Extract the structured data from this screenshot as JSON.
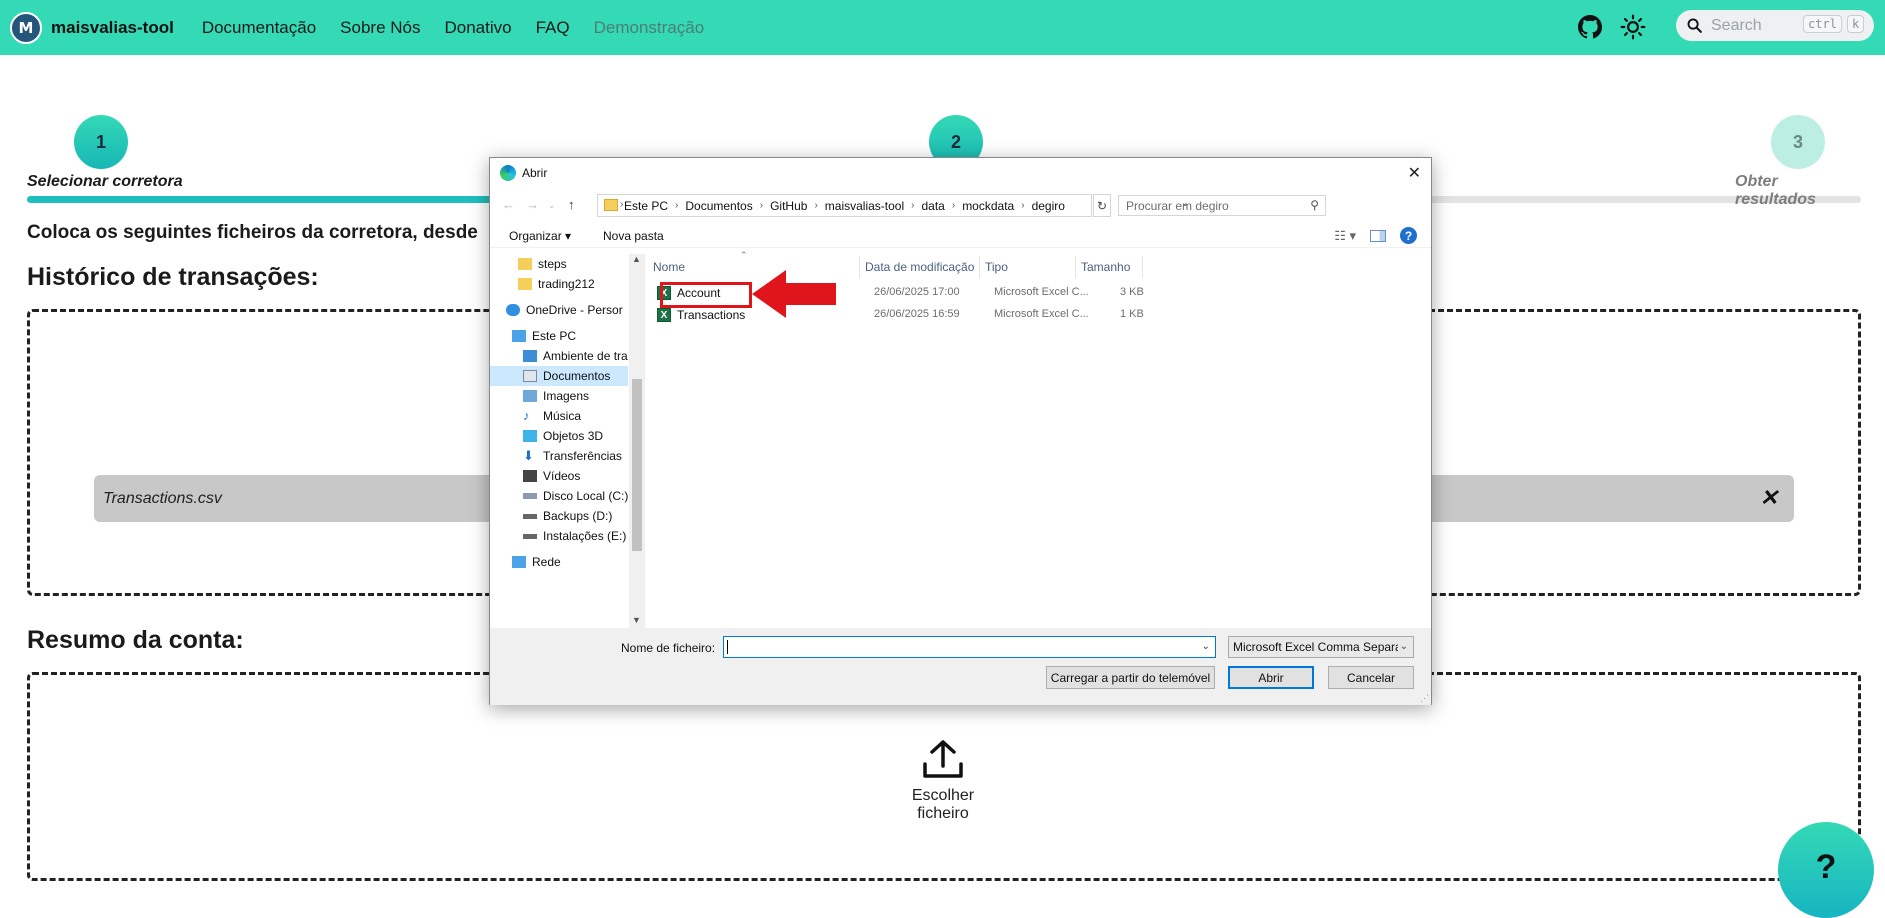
{
  "navbar": {
    "brand": "maisvalias-tool",
    "links": [
      "Documentação",
      "Sobre Nós",
      "Donativo",
      "FAQ",
      "Demonstração"
    ],
    "search_placeholder": "Search",
    "kbd_ctrl": "ctrl",
    "kbd_k": "k",
    "icons": [
      "github-icon",
      "sun-icon",
      "search-icon"
    ]
  },
  "stepper": {
    "steps": [
      {
        "number": "1",
        "label": "Selecionar corretora"
      },
      {
        "number": "2",
        "label": ""
      },
      {
        "number": "3",
        "label": "Obter resultados"
      }
    ]
  },
  "main": {
    "intro": "Coloca os seguintes ficheiros da corretora, desde",
    "section1_title": "Histórico de transações:",
    "uploaded_file": "Transactions.csv",
    "section2_title": "Resumo da conta:",
    "upload_label": "Escolher ficheiro",
    "help_label": "?"
  },
  "dialog": {
    "title": "Abrir",
    "breadcrumb": [
      "Este PC",
      "Documentos",
      "GitHub",
      "maisvalias-tool",
      "data",
      "mockdata",
      "degiro"
    ],
    "search_placeholder": "Procurar em degiro",
    "toolbar": {
      "organize": "Organizar ▾",
      "new_folder": "Nova pasta"
    },
    "nav_items": [
      {
        "label": "steps",
        "icon": "folder-icon"
      },
      {
        "label": "trading212",
        "icon": "folder-icon"
      },
      {
        "label": "OneDrive - Persor",
        "icon": "onedrive-icon"
      },
      {
        "label": "Este PC",
        "icon": "pc-icon"
      },
      {
        "label": "Ambiente de tra",
        "icon": "desktop-icon"
      },
      {
        "label": "Documentos",
        "icon": "documents-icon"
      },
      {
        "label": "Imagens",
        "icon": "pictures-icon"
      },
      {
        "label": "Música",
        "icon": "music-icon"
      },
      {
        "label": "Objetos 3D",
        "icon": "objects3d-icon"
      },
      {
        "label": "Transferências",
        "icon": "downloads-icon"
      },
      {
        "label": "Vídeos",
        "icon": "videos-icon"
      },
      {
        "label": "Disco Local (C:)",
        "icon": "drive-icon"
      },
      {
        "label": "Backups (D:)",
        "icon": "drive-icon"
      },
      {
        "label": "Instalações (E:)",
        "icon": "drive-icon"
      },
      {
        "label": "Rede",
        "icon": "network-icon"
      }
    ],
    "columns": [
      "Nome",
      "Data de modificação",
      "Tipo",
      "Tamanho"
    ],
    "files": [
      {
        "name": "Account",
        "modified": "26/06/2025 17:00",
        "type": "Microsoft Excel C...",
        "size": "3 KB"
      },
      {
        "name": "Transactions",
        "modified": "26/06/2025 16:59",
        "type": "Microsoft Excel C...",
        "size": "1 KB"
      }
    ],
    "filename_label": "Nome de ficheiro:",
    "filename_value": "",
    "filetype": "Microsoft Excel Comma Separa",
    "phone_button": "Carregar a partir do telemóvel",
    "open_button": "Abrir",
    "cancel_button": "Cancelar"
  },
  "colors": {
    "accent": "#34d9b5",
    "teal": "#17b6b6",
    "annotation": "#e0151b"
  }
}
